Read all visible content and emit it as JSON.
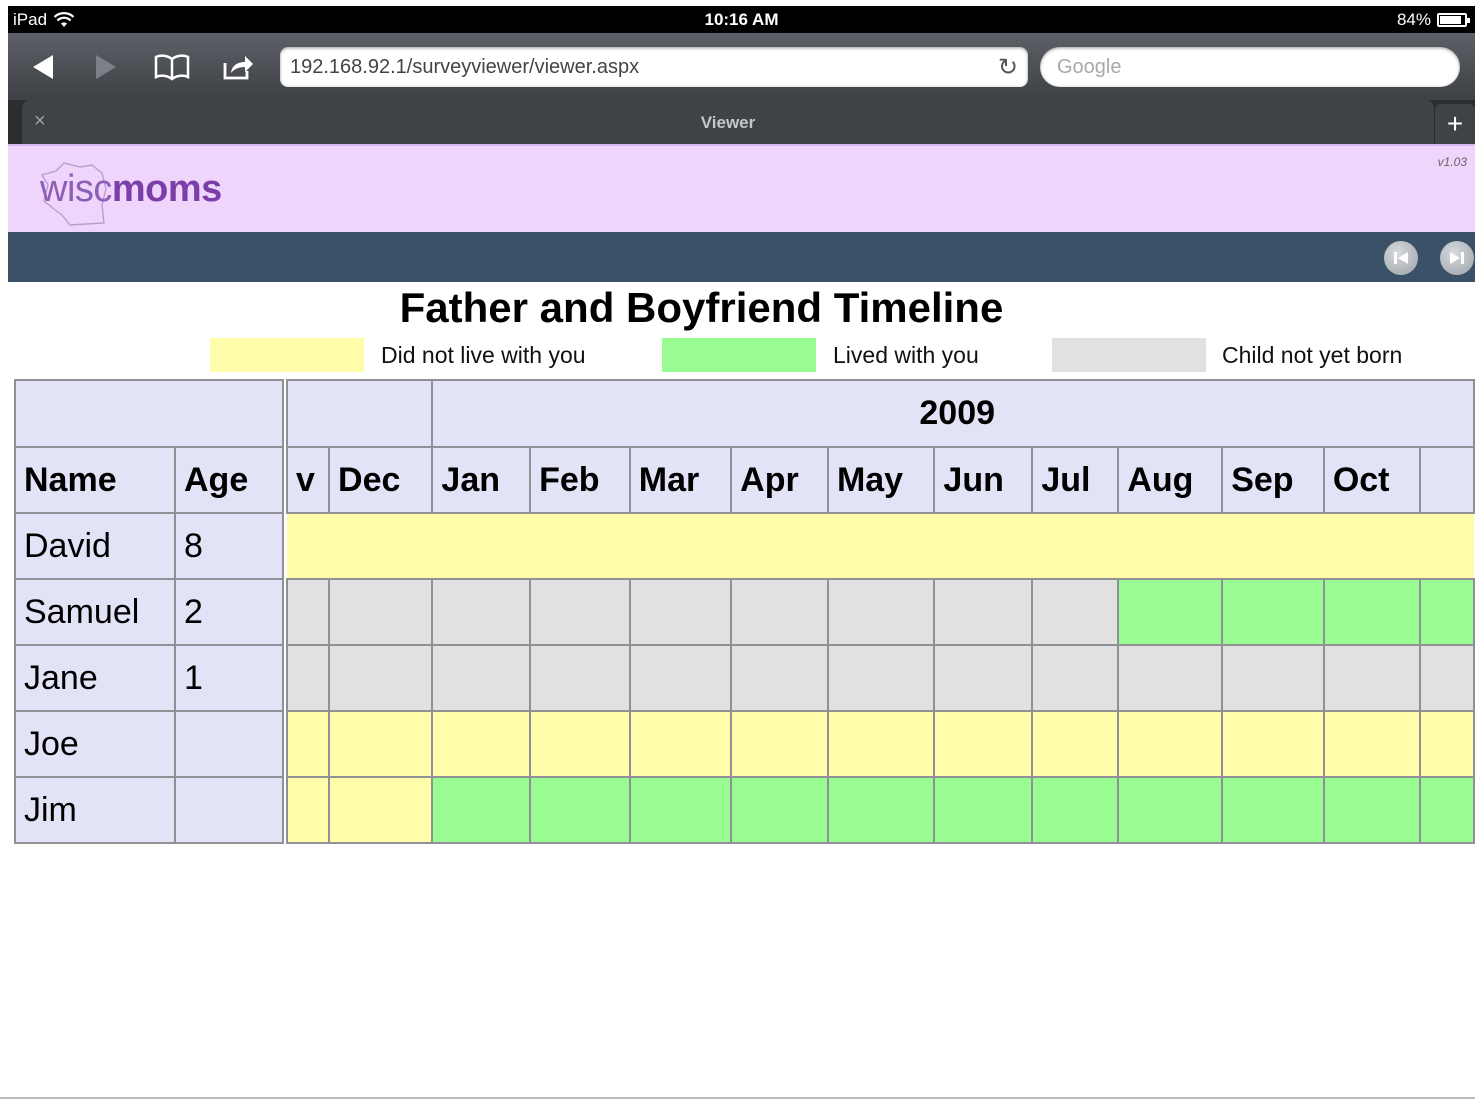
{
  "status_bar": {
    "device": "iPad",
    "time": "10:16 AM",
    "battery": "84%"
  },
  "browser": {
    "url": "192.168.92.1/surveyviewer/viewer.aspx",
    "search_placeholder": "Google",
    "tab_title": "Viewer",
    "tab_close": "×",
    "new_tab": "+"
  },
  "app": {
    "logo_part1": "wisc",
    "logo_part2": "moms",
    "version": "v1.03"
  },
  "page": {
    "title": "Father and Boyfriend Timeline",
    "legend": [
      {
        "label": "Did not live with you",
        "color": "#fffcaa"
      },
      {
        "label": "Lived with you",
        "color": "#99fc92"
      },
      {
        "label": "Child not yet born",
        "color": "#e1e1e1"
      }
    ]
  },
  "table": {
    "name_header": "Name",
    "age_header": "Age",
    "year": "2009",
    "partial_month": "v",
    "months": [
      "Dec",
      "Jan",
      "Feb",
      "Mar",
      "Apr",
      "May",
      "Jun",
      "Jul",
      "Aug",
      "Sep",
      "Oct"
    ],
    "rows": [
      {
        "name": "David",
        "age": "8"
      },
      {
        "name": "Samuel",
        "age": "2"
      },
      {
        "name": "Jane",
        "age": "1"
      },
      {
        "name": "Joe",
        "age": ""
      },
      {
        "name": "Jim",
        "age": ""
      }
    ]
  }
}
